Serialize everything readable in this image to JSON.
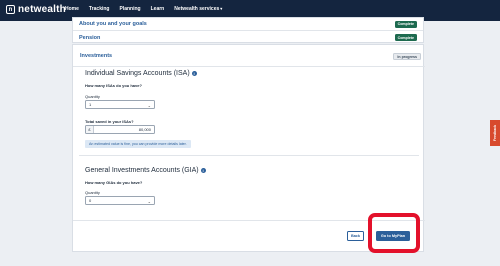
{
  "brand": {
    "name": "netwealth",
    "logo_icon": "netwealth-logo-icon"
  },
  "nav": {
    "items": [
      "Home",
      "Tracking",
      "Planning",
      "Learn",
      "Netwealth services"
    ]
  },
  "sections": {
    "about": {
      "title": "About you and your goals",
      "status": "Complete"
    },
    "pension": {
      "title": "Pension",
      "status": "Complete"
    },
    "investments": {
      "title": "Investments",
      "status": "In progress"
    }
  },
  "isa": {
    "title": "Individual Savings Accounts (ISA)",
    "question": "How many ISAs do you have?",
    "quantity_label": "Quantity",
    "quantity_value": "1",
    "total_label": "Total saved in your ISAs?",
    "currency": "£",
    "total_value": "80,000",
    "hint": "An estimated value is fine, you can provide more details later."
  },
  "gia": {
    "title": "General Investments Accounts (GIA)",
    "question": "How many GIAs do you have?",
    "quantity_label": "Quantity",
    "quantity_value": "0"
  },
  "actions": {
    "back": "Back",
    "go": "Go to MyPlan"
  },
  "feedback": {
    "label": "Feedback"
  },
  "colors": {
    "nav": "#14253f",
    "accent": "#2b5f9a",
    "complete": "#1d6a4f",
    "highlight": "#e3112b",
    "feedback": "#d84a2d"
  }
}
